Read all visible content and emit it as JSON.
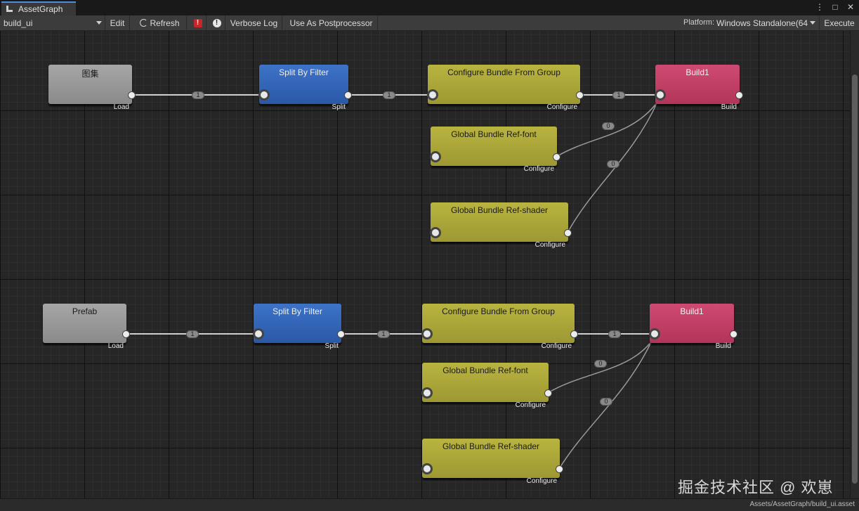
{
  "window": {
    "tab_title": "AssetGraph",
    "menu_glyph": "⋮",
    "maximize_glyph": "□",
    "close_glyph": "✕"
  },
  "toolbar": {
    "graph_select": "build_ui",
    "edit": "Edit",
    "refresh": "Refresh",
    "error_glyph": "!",
    "warning_glyph": "!",
    "verbose_log": "Verbose Log",
    "use_as_postprocessor": "Use As Postprocessor",
    "platform_label": "Platform:",
    "platform_value": "Windows Standalone(64",
    "execute": "Execute"
  },
  "colors": {
    "load": "#959595",
    "split": "#3264b8",
    "configure": "#aca638",
    "build": "#c23f65",
    "accent": "#4d8ddb"
  },
  "graph": {
    "row1": {
      "load": {
        "title": "图集",
        "kind": "Load"
      },
      "split": {
        "title": "Split By Filter",
        "kind": "Split"
      },
      "group": {
        "title": "Configure Bundle From Group",
        "kind": "Configure"
      },
      "build": {
        "title": "Build1",
        "kind": "Build"
      },
      "font": {
        "title": "Global Bundle Ref-font",
        "kind": "Configure"
      },
      "shader": {
        "title": "Global Bundle Ref-shader",
        "kind": "Configure"
      },
      "edges": {
        "load_split": "1",
        "split_group": "1",
        "group_build": "1",
        "font_build": "0",
        "shader_build": "0"
      }
    },
    "row2": {
      "load": {
        "title": "Prefab",
        "kind": "Load"
      },
      "split": {
        "title": "Split By Filter",
        "kind": "Split"
      },
      "group": {
        "title": "Configure Bundle From Group",
        "kind": "Configure"
      },
      "build": {
        "title": "Build1",
        "kind": "Build"
      },
      "font": {
        "title": "Global Bundle Ref-font",
        "kind": "Configure"
      },
      "shader": {
        "title": "Global Bundle Ref-shader",
        "kind": "Configure"
      },
      "edges": {
        "load_split": "1",
        "split_group": "1",
        "group_build": "1",
        "font_build": "0",
        "shader_build": "0"
      }
    }
  },
  "status": {
    "asset_path": "Assets/AssetGraph/build_ui.asset"
  },
  "watermark": "掘金技术社区 @ 欢崽"
}
